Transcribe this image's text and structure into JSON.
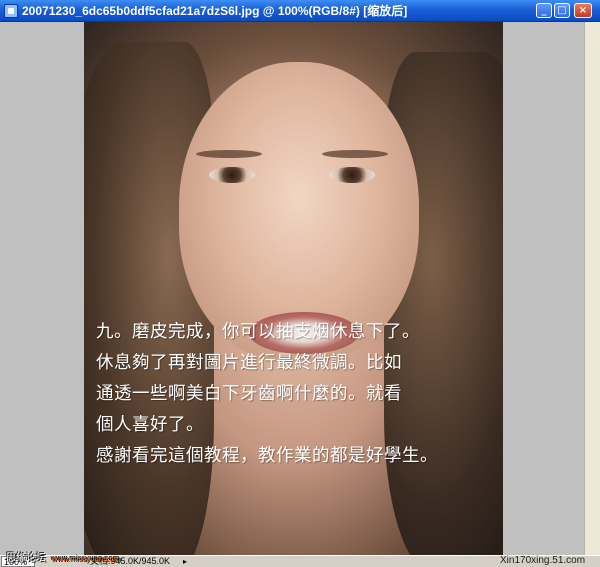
{
  "window": {
    "title": "20071230_6dc65b0ddf5cfad21a7dzS6l.jpg @ 100%(RGB/8#) [缩放后]",
    "controls": {
      "minimize": "_",
      "maximize": "□",
      "close": "×"
    }
  },
  "canvas": {
    "overlay_lines": [
      "九。磨皮完成，你可以抽支烟休息下了。",
      "休息夠了再對圖片進行最終微調。比如",
      "通透一些啊美白下牙齒啊什麼的。就看",
      "個人喜好了。",
      "感謝看完這個教程，教作業的都是好學生。"
    ]
  },
  "statusbar": {
    "zoom": "100%",
    "doc_info": "文档:945.0K/945.0K",
    "arrow": "▸"
  },
  "watermarks": {
    "left": "思缘论坛",
    "left_sub": "www.missyuan.com",
    "right": "Xin170xing.51.com"
  }
}
